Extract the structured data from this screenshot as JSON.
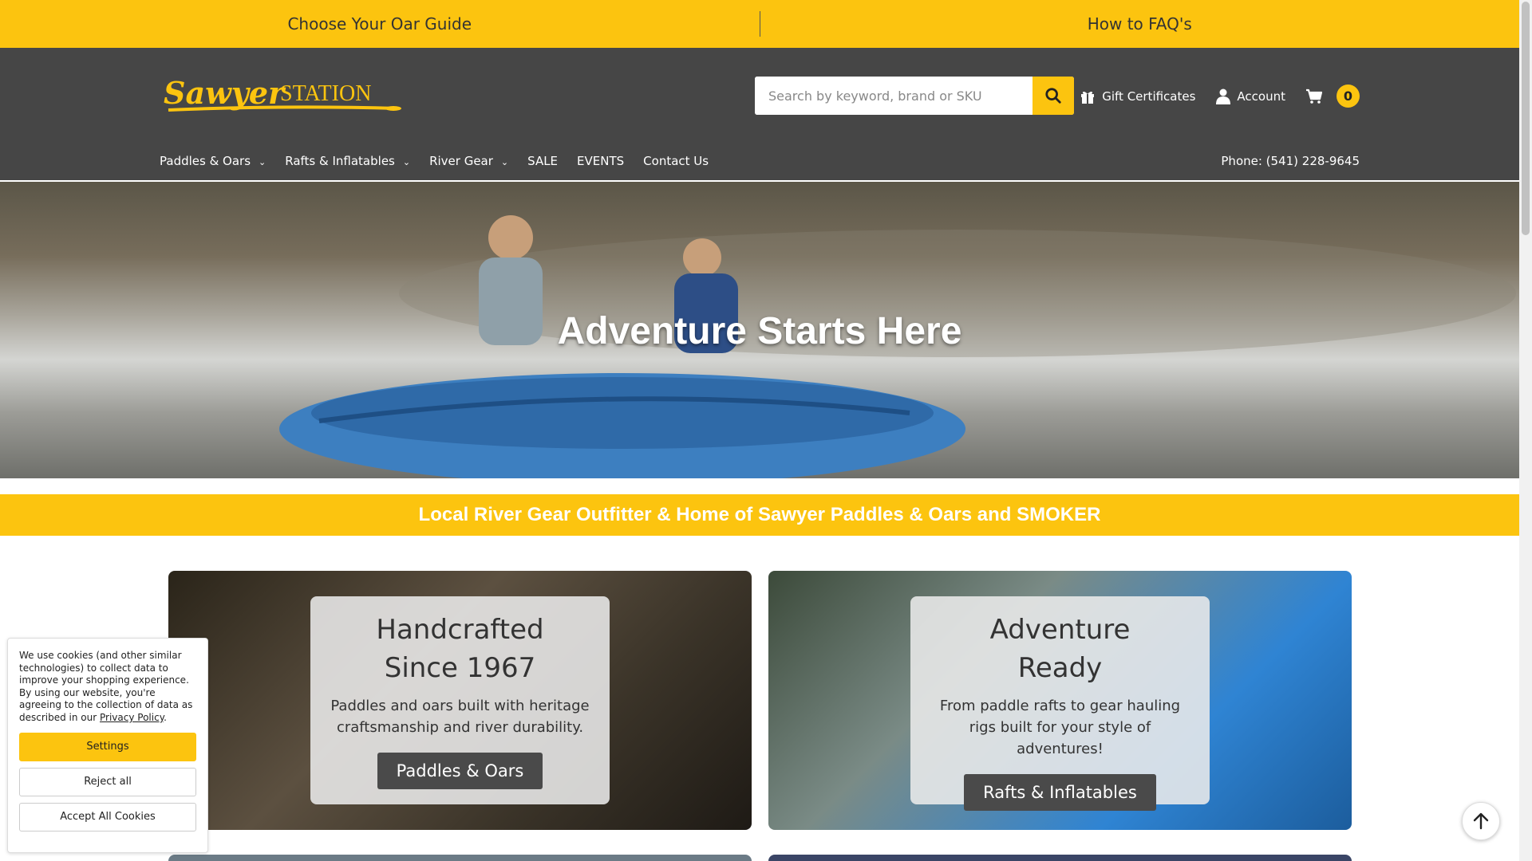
{
  "topbar": {
    "link1": "Choose Your Oar Guide",
    "link2": "How to FAQ's"
  },
  "header": {
    "logo_text_script": "Sawyer",
    "logo_text_caps": "STATION",
    "search_placeholder": "Search by keyword, brand or SKU",
    "gift_label": "Gift Certificates",
    "account_label": "Account",
    "cart_count": "0",
    "phone": "Phone: (541) 228-9645"
  },
  "nav": {
    "items": [
      {
        "label": "Paddles & Oars",
        "dropdown": true
      },
      {
        "label": "Rafts & Inflatables",
        "dropdown": true
      },
      {
        "label": "River Gear",
        "dropdown": true
      },
      {
        "label": "SALE",
        "dropdown": false
      },
      {
        "label": "EVENTS",
        "dropdown": false
      },
      {
        "label": "Contact Us",
        "dropdown": false
      }
    ]
  },
  "hero": {
    "title": "Adventure Starts Here"
  },
  "tagline": "Local River Gear Outfitter & Home of Sawyer Paddles & Oars and SMOKER",
  "cards": [
    {
      "title_line1": "Handcrafted",
      "title_line2": "Since 1967",
      "text": "Paddles and oars built with heritage craftsmanship and river durability.",
      "button": "Paddles & Oars"
    },
    {
      "title_line1": "Adventure",
      "title_line2": "Ready",
      "text": "From paddle rafts to gear hauling rigs built for your style of adventures!",
      "button": "Rafts & Inflatables"
    }
  ],
  "cookie": {
    "text": "We use cookies (and other similar technologies) to collect data to improve your shopping experience. By using our website, you're agreeing to the collection of data as described in our",
    "link": "Privacy Policy",
    "link_suffix": ".",
    "settings": "Settings",
    "reject": "Reject all",
    "accept": "Accept All Cookies"
  },
  "colors": {
    "accent": "#fcc40f",
    "header_bg": "#464646"
  },
  "icons": [
    "search-icon",
    "gift-icon",
    "user-icon",
    "cart-icon",
    "chevron-down-icon",
    "arrow-up-icon"
  ]
}
